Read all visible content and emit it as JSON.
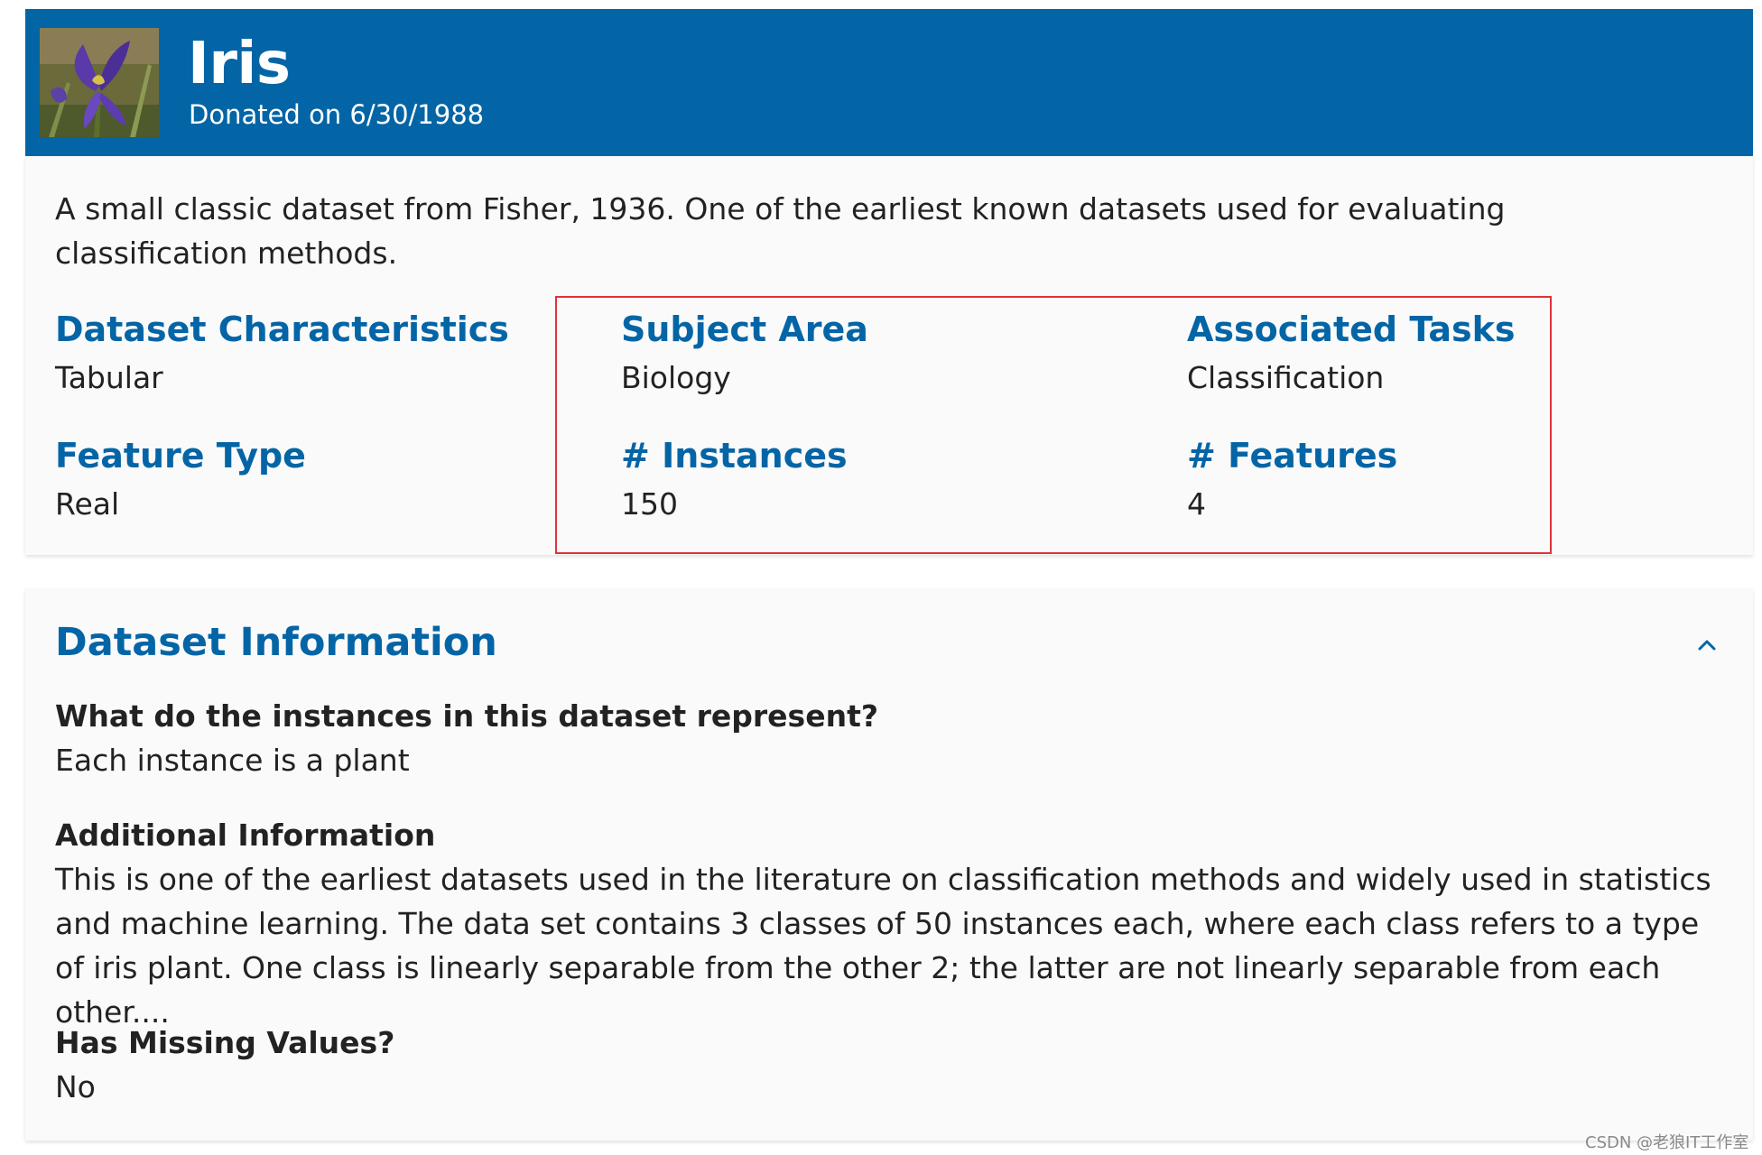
{
  "header": {
    "title": "Iris",
    "donated": "Donated on 6/30/1988",
    "thumbnail_icon": "iris-flower-photo"
  },
  "summary": {
    "abstract": "A small classic dataset from Fisher, 1936. One of the earliest known datasets used for evaluating classification methods.",
    "characteristics_label": "Dataset Characteristics",
    "characteristics_value": "Tabular",
    "subject_label": "Subject Area",
    "subject_value": "Biology",
    "tasks_label": "Associated Tasks",
    "tasks_value": "Classification",
    "feature_type_label": "Feature Type",
    "feature_type_value": "Real",
    "instances_label": "# Instances",
    "instances_value": "150",
    "features_label": "# Features",
    "features_value": "4"
  },
  "info": {
    "title": "Dataset Information",
    "toggle_icon": "chevron-up-icon",
    "q1": "What do the instances in this dataset represent?",
    "a1": "Each instance is a plant",
    "q2": "Additional Information",
    "a2": "This is one of the earliest datasets used in the literature on classification methods and widely used in statistics and machine learning.  The data set contains 3 classes of 50 instances each, where each class refers to a type of iris plant. One class is linearly separable from the other 2; the latter are not linearly separable from each other....",
    "q3": "Has Missing Values?",
    "a3": "No"
  },
  "watermark": "CSDN @老狼IT工作室",
  "colors": {
    "brand_blue": "#0465a6",
    "highlight_red": "#e0323a",
    "card_bg": "#fafafa"
  }
}
